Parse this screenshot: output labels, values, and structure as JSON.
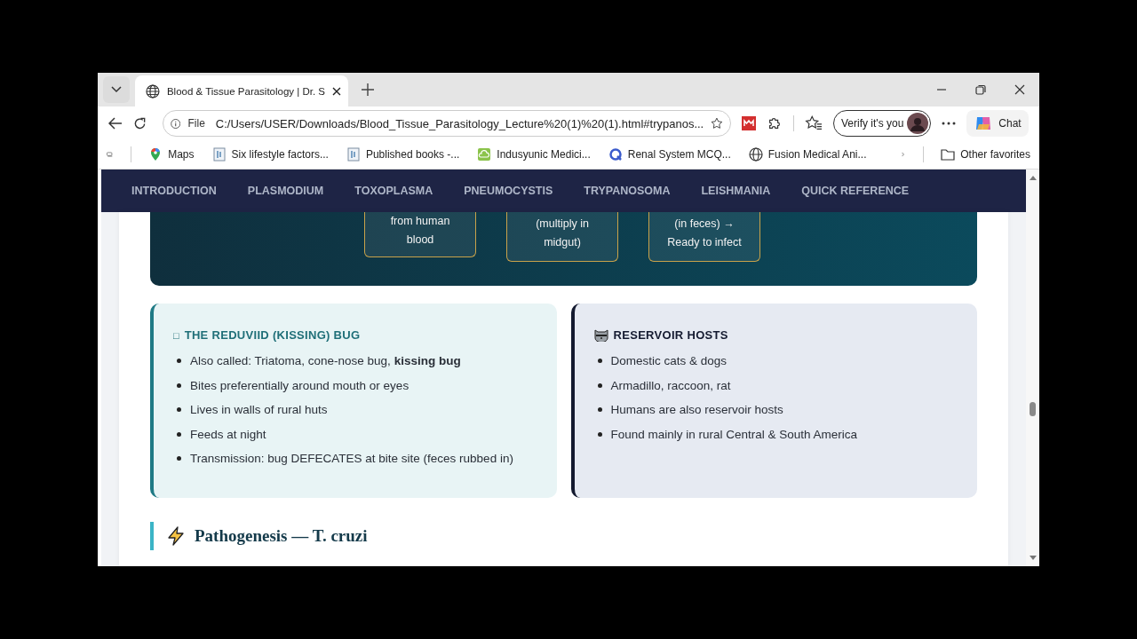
{
  "browser": {
    "tab": {
      "title": "Blood & Tissue Parasitology | Dr. S"
    },
    "address": {
      "scheme": "File",
      "url": "C:/Users/USER/Downloads/Blood_Tissue_Parasitology_Lecture%20(1)%20(1).html#trypanos..."
    },
    "profile_button": "Verify it's you",
    "chat_button": "Chat",
    "bookmarks": [
      {
        "label": "Maps",
        "kind": "pin"
      },
      {
        "label": "Six lifestyle factors...",
        "kind": "doc"
      },
      {
        "label": "Published books -...",
        "kind": "doc"
      },
      {
        "label": "Indusyunic Medici...",
        "kind": "cloud"
      },
      {
        "label": "Renal System MCQ...",
        "kind": "q"
      },
      {
        "label": "Fusion Medical Ani...",
        "kind": "globe"
      }
    ],
    "other_favorites": "Other favorites"
  },
  "page": {
    "nav": [
      "INTRODUCTION",
      "PLASMODIUM",
      "TOXOPLASMA",
      "PNEUMOCYSTIS",
      "TRYPANOSOMA",
      "LEISHMANIA",
      "QUICK REFERENCE"
    ],
    "flow_steps": [
      {
        "lines": [
          "from human",
          "blood"
        ]
      },
      {
        "lines": [
          "(multiply in",
          "midgut)"
        ]
      },
      {
        "lines": [
          "(in feces) →",
          "Ready to infect"
        ]
      }
    ],
    "cards": [
      {
        "kind": "vector",
        "icon_glyph": "□",
        "title": "THE REDUVIID (KISSING) BUG",
        "items": [
          "Also called: Triatoma, cone-nose bug, **kissing bug**",
          "Bites preferentially around mouth or eyes",
          "Lives in walls of rural huts",
          "Feeds at night",
          "Transmission: bug DEFECATES at bite site (feces rubbed in)"
        ]
      },
      {
        "kind": "hosts",
        "title": "RESERVOIR HOSTS",
        "items": [
          "Domestic cats & dogs",
          "Armadillo, raccoon, rat",
          "Humans are also reservoir hosts",
          "Found mainly in rural Central & South America"
        ]
      }
    ],
    "section_heading": "Pathogenesis — T. cruzi"
  }
}
